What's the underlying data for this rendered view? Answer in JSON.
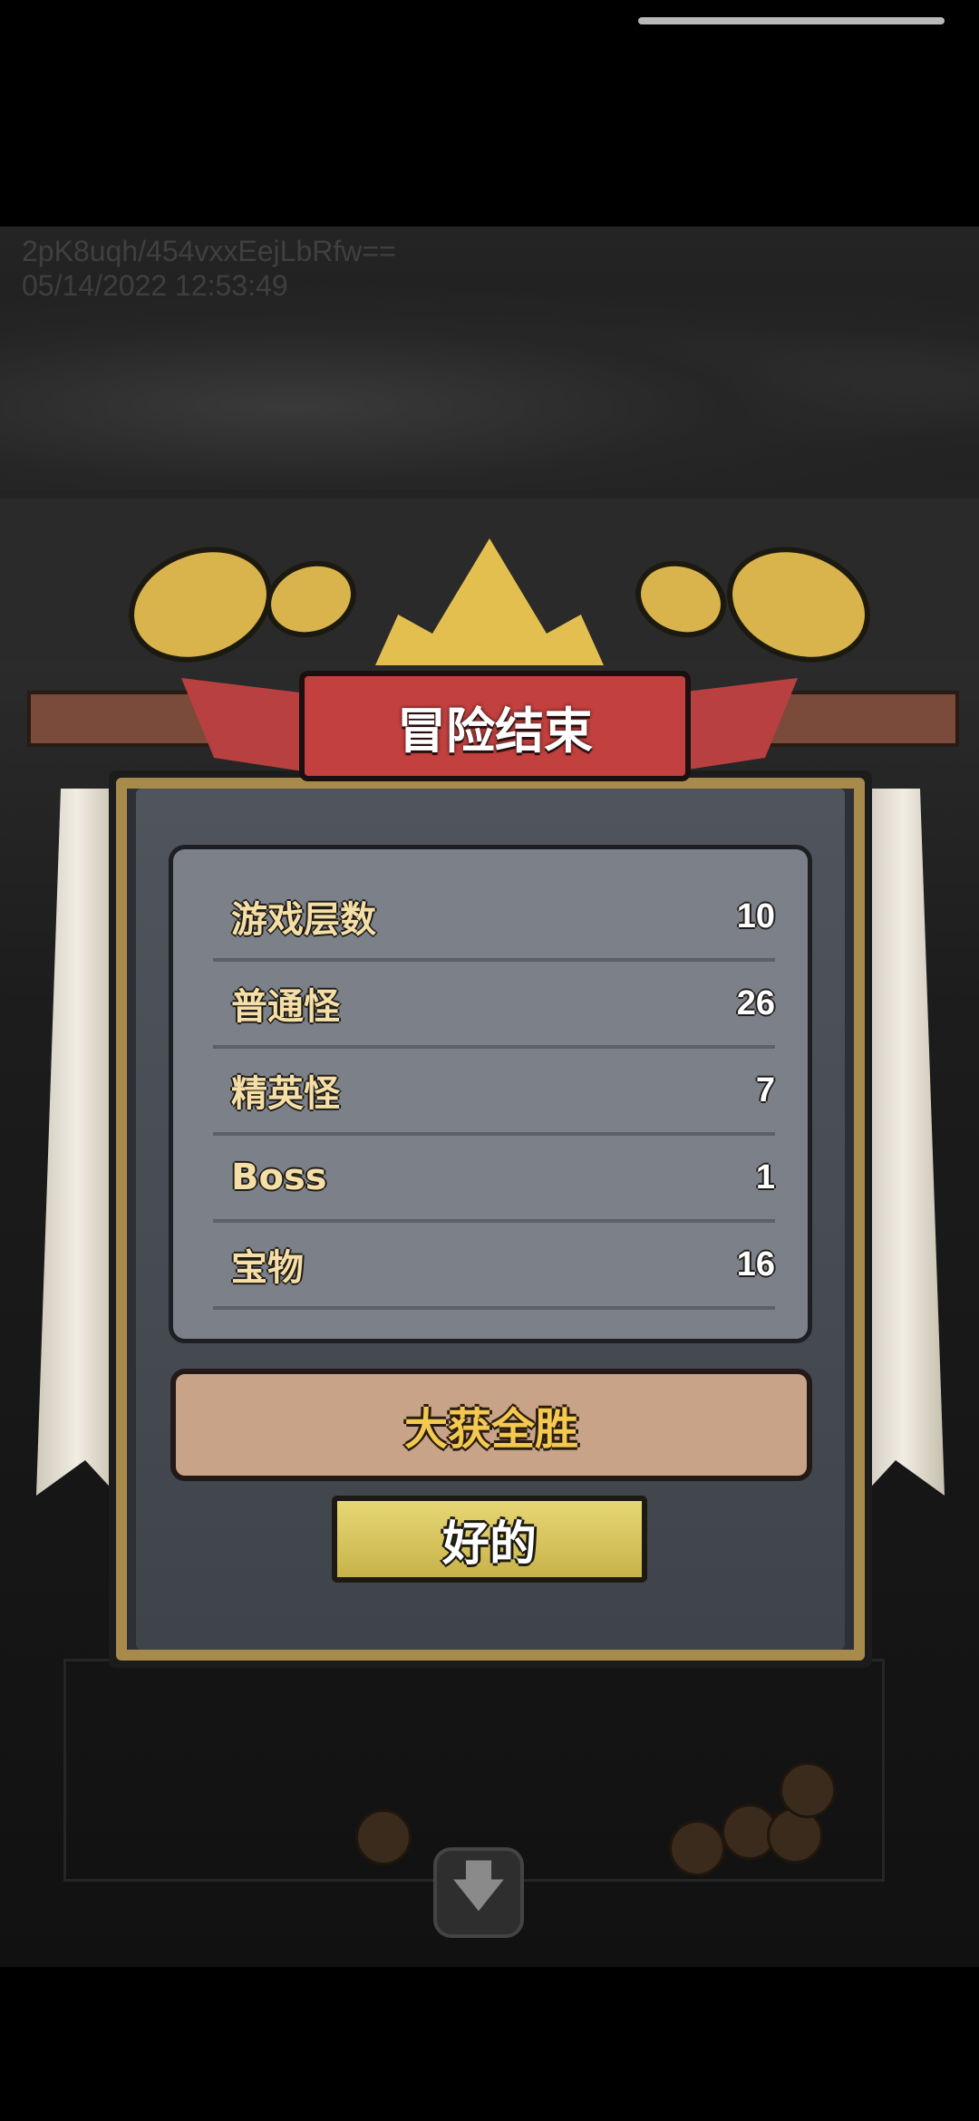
{
  "overlay": {
    "id_text": "2pK8uqh/454vxxEejLbRfw==",
    "datetime_text": "05/14/2022 12:53:49"
  },
  "dialog": {
    "title": "冒险结束",
    "stats": [
      {
        "label": "游戏层数",
        "value": "10"
      },
      {
        "label": "普通怪",
        "value": "26"
      },
      {
        "label": "精英怪",
        "value": "7"
      },
      {
        "label": "Boss",
        "value": "1"
      },
      {
        "label": "宝物",
        "value": "16"
      }
    ],
    "result_text": "大获全胜",
    "ok_button_label": "好的"
  },
  "icons": {
    "down_arrow": "arrow-down-icon",
    "crown": "crown-icon",
    "trumpet": "trumpet-icon"
  },
  "colors": {
    "ribbon": "#c2413f",
    "stat_label": "#f6dfa6",
    "victory_text": "#f3c94f",
    "ok_button": "#e6d774"
  }
}
